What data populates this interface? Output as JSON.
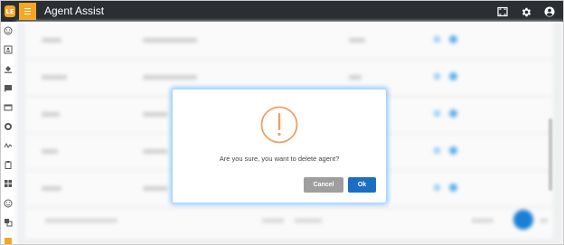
{
  "header": {
    "logo_text": "LE",
    "title": "Agent Assist",
    "icons": [
      "fullscreen-icon",
      "gear-icon",
      "user-account-icon"
    ]
  },
  "sidebar": {
    "icons": [
      "smiley-icon",
      "contact-card-icon",
      "paint-bucket-icon",
      "chat-icon",
      "monitor-icon",
      "circle-icon",
      "signature-icon",
      "clipboard-icon",
      "apps-grid-icon",
      "smiley-icon",
      "translate-icon",
      "square-icon"
    ]
  },
  "dialog": {
    "message": "Are you sure, you want to delete agent?",
    "cancel_label": "Cancel",
    "ok_label": "Ok"
  },
  "colors": {
    "topbar": "#2b2f33",
    "accent": "#f5a623",
    "warning": "#f0a060",
    "primary": "#1a6fc4",
    "cancel": "#9e9e9e"
  }
}
